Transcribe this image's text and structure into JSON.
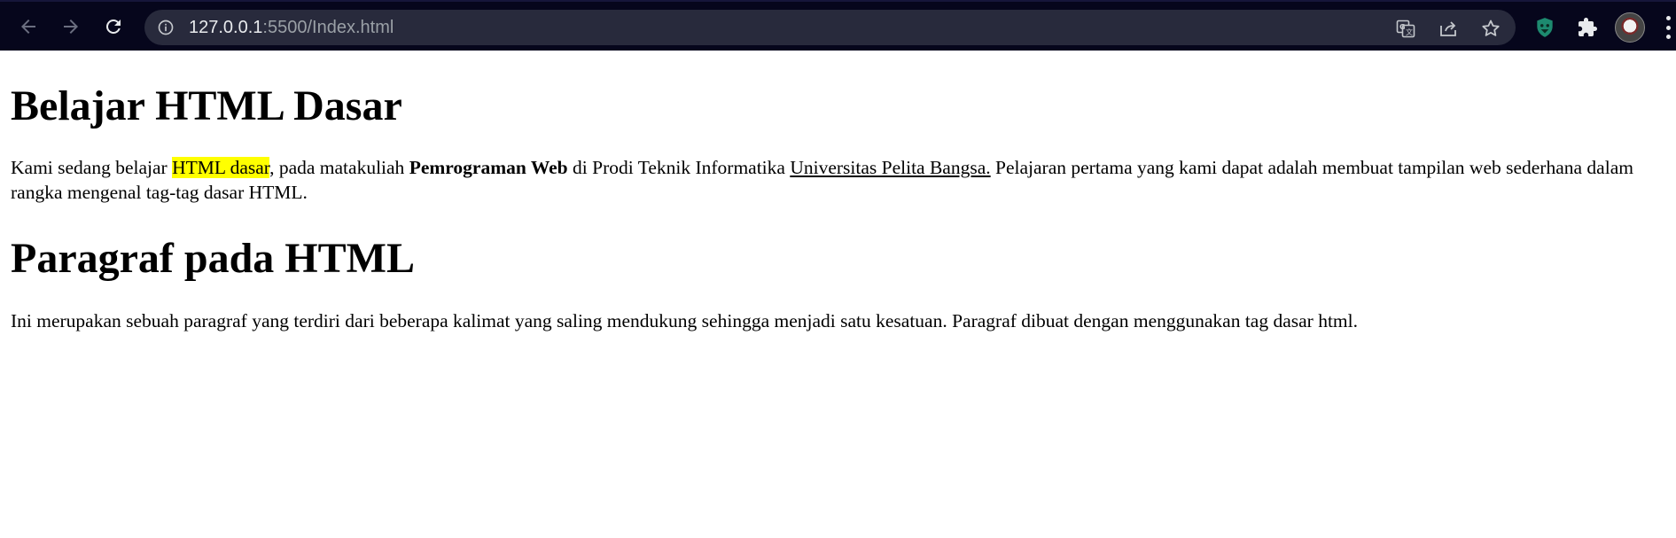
{
  "browser": {
    "url_host": "127.0.0.1",
    "url_rest": ":5500/Index.html",
    "icons": {
      "back": "back-arrow-icon",
      "forward": "forward-arrow-icon",
      "reload": "reload-icon",
      "site_info": "info-icon",
      "translate": "translate-icon",
      "share": "share-icon",
      "bookmark": "star-icon",
      "extension_1": "extension-shield-icon",
      "extensions": "puzzle-icon",
      "profile": "avatar",
      "menu": "kebab-menu-icon"
    },
    "colors": {
      "toolbar_bg": "#06061c",
      "omnibox_bg": "#282a3c"
    }
  },
  "page": {
    "heading1": "Belajar HTML Dasar",
    "para1": {
      "t1": "Kami sedang belajar ",
      "highlight": "HTML dasar",
      "t2": ", pada matakuliah ",
      "bold": "Pemrograman Web",
      "t3": " di Prodi Teknik Informatika ",
      "underline": "Universitas Pelita Bangsa.",
      "t4": " Pelajaran pertama yang kami dapat adalah membuat tampilan web sederhana dalam rangka mengenal tag-tag dasar HTML."
    },
    "heading2": "Paragraf pada HTML",
    "para2": "Ini merupakan sebuah paragraf yang terdiri dari beberapa kalimat yang saling mendukung sehingga menjadi satu kesatuan. Paragraf dibuat dengan menggunakan tag dasar html.",
    "colors": {
      "highlight": "#ffff00"
    }
  }
}
